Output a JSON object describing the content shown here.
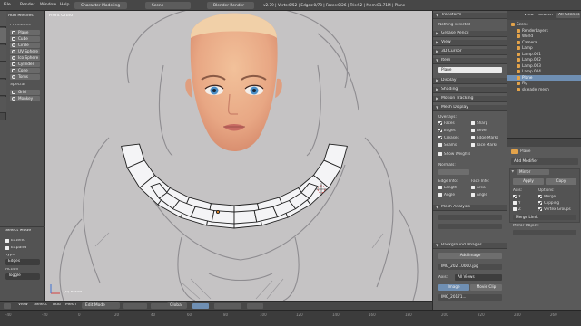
{
  "topbar": {
    "menus": [
      "File",
      "Render",
      "Window",
      "Help"
    ],
    "screen_layout": "Character Modeling",
    "scene": "Scene",
    "render_engine": "Blender Render",
    "stats": "v2.79 | Verts:0/52 | Edges:0/78 | Faces:0/26 | Tris:52 | Mem:81.71M | Plane"
  },
  "toolshelf": {
    "tabs": [
      "Tools",
      "Create",
      "Relations",
      "Shading / UVs",
      "Options",
      "Grease Pencil"
    ],
    "add_mesh_header": "Add Meshes",
    "primitives_label": "Primitives",
    "primitives": [
      "Plane",
      "Cube",
      "Circle",
      "UV Sphere",
      "Ico Sphere",
      "Cylinder",
      "Cone",
      "Torus"
    ],
    "special_label": "Special",
    "special": [
      "Grid",
      "Monkey"
    ],
    "select_mode_header": "Select Mode",
    "select_mode_options": [
      "Extend",
      "Expand"
    ],
    "type_label": "Type",
    "type_value": "Edges",
    "action_label": "Action",
    "action_value": "Toggle"
  },
  "viewport": {
    "view_label": "Front Ortho",
    "object_label": "(0) Plane"
  },
  "viewport_header": {
    "items": [
      "View",
      "Select",
      "Add",
      "Mesh",
      "Edit Mode",
      "Global"
    ]
  },
  "properties": {
    "transform": "Transform",
    "nothing_selected": "Nothing selected",
    "grease_pencil": "Grease Pencil",
    "view": "View",
    "cursor_3d": "3D Cursor",
    "item": "Item",
    "item_name": "Plane",
    "display": "Display",
    "shading": "Shading",
    "motion_tracking": "Motion Tracking",
    "mesh_display": "Mesh Display",
    "overlays_label": "Overlays:",
    "overlays": [
      {
        "label": "Faces",
        "checked": true
      },
      {
        "label": "Sharp",
        "checked": false
      },
      {
        "label": "Edges",
        "checked": true
      },
      {
        "label": "Bevel",
        "checked": false
      },
      {
        "label": "Creases",
        "checked": true
      },
      {
        "label": "Edge Marks",
        "checked": false
      },
      {
        "label": "Seams",
        "checked": false
      },
      {
        "label": "Face Marks",
        "checked": false
      }
    ],
    "show_weights": "Show Weights",
    "normals_label": "Normals:",
    "edge_info_label": "Edge Info:",
    "face_info_label": "Face Info:",
    "edge_info": [
      {
        "label": "Length",
        "checked": false
      },
      {
        "label": "Angle",
        "checked": false
      }
    ],
    "face_info": [
      {
        "label": "Area",
        "checked": false
      },
      {
        "label": "Angle",
        "checked": false
      }
    ],
    "mesh_analysis": "Mesh Analysis",
    "background_images": "Background Images",
    "add_image": "Add Image",
    "image_name": "IMG_202...0000.jpg",
    "axis_label": "Axis:",
    "axis_value": "All Views",
    "image_tab": "Image",
    "movie_clip_tab": "Movie Clip",
    "image_file": "IMG_20171..."
  },
  "outliner": {
    "view_tabs": [
      "View",
      "Search",
      "All Scenes"
    ],
    "items": [
      {
        "label": "Scene",
        "indent": 0,
        "selected": false
      },
      {
        "label": "RenderLayers",
        "indent": 1,
        "selected": false
      },
      {
        "label": "World",
        "indent": 1,
        "selected": false
      },
      {
        "label": "Camera",
        "indent": 1,
        "selected": false
      },
      {
        "label": "Lamp",
        "indent": 1,
        "selected": false
      },
      {
        "label": "Lamp.001",
        "indent": 1,
        "selected": false
      },
      {
        "label": "Lamp.002",
        "indent": 1,
        "selected": false
      },
      {
        "label": "Lamp.003",
        "indent": 1,
        "selected": false
      },
      {
        "label": "Lamp.004",
        "indent": 1,
        "selected": false
      },
      {
        "label": "Plane",
        "indent": 1,
        "selected": true
      },
      {
        "label": "Fig",
        "indent": 1,
        "selected": false
      },
      {
        "label": "skleade_mesh",
        "indent": 1,
        "selected": false
      }
    ]
  },
  "modifier": {
    "object_name": "Plane",
    "add_modifier": "Add Modifier",
    "modifier_name": "Mirror",
    "apply": "Apply",
    "copy": "Copy",
    "axis_label": "Axis:",
    "options_label": "Options:",
    "axes": [
      {
        "label": "X",
        "checked": true
      },
      {
        "label": "Y",
        "checked": false
      },
      {
        "label": "Z",
        "checked": false
      }
    ],
    "options": [
      {
        "label": "Merge",
        "checked": true
      },
      {
        "label": "Clipping",
        "checked": true
      },
      {
        "label": "Vertex Groups",
        "checked": true
      }
    ],
    "merge_limit": "Merge Limit",
    "mirror_object": "Mirror Object:"
  },
  "timeline": {
    "ticks": [
      "-40",
      "-20",
      "0",
      "20",
      "40",
      "60",
      "80",
      "100",
      "120",
      "140",
      "160",
      "180",
      "200",
      "220",
      "240",
      "260"
    ]
  },
  "colors": {
    "selection": "#6f8fb3",
    "vertex_select": "#e58a2d",
    "viewport_bg": "#c5c3c4"
  }
}
